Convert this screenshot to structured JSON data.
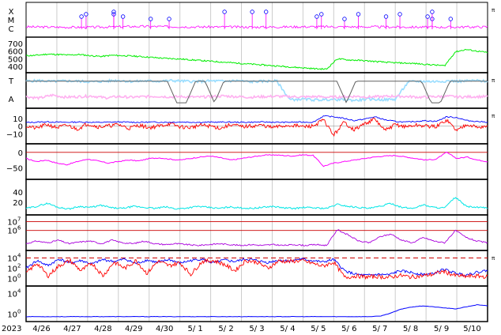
{
  "chart_data": {
    "type": "line",
    "year_label": "2023",
    "dates": [
      "4/26",
      "4/27",
      "4/28",
      "4/29",
      "4/30",
      "5/ 1",
      "5/ 2",
      "5/ 3",
      "5/ 4",
      "5/ 5",
      "5/ 6",
      "5/ 7",
      "5/ 8",
      "5/ 9",
      "5/10"
    ],
    "side_mark": "π",
    "colors": {
      "magenta": "#ff00ff",
      "green": "#00ee00",
      "lightblue": "#99ddff",
      "pink": "#ffb0f0",
      "gray": "#606060",
      "blue": "#0000ff",
      "red": "#ff0000",
      "purple": "#aa00dd",
      "cyan": "#00e6e6",
      "darkred": "#cc0000",
      "grid": "#cccccc"
    },
    "panels": [
      {
        "id": "flare",
        "row_labels": [
          "X",
          "M",
          "C"
        ],
        "side_mark": true,
        "event_markers": [
          0.19,
          0.72,
          0.12,
          0.88,
          0.43,
          0.81,
          0.21,
          0.69,
          0.52,
          0.64,
          0.78,
          0.31,
          0.49,
          0.13,
          0.63,
          0.27,
          0.88,
          0.19,
          0.87,
          0.92
        ]
      },
      {
        "id": "solar-wind-speed",
        "yticks": [
          "700",
          "600",
          "500",
          "400"
        ],
        "ylim": [
          350,
          750
        ],
        "series": [
          {
            "color_key": "green",
            "values": [
              540,
              545,
              560,
              555,
              548,
              555,
              540,
              530,
              545,
              540,
              535,
              525,
              515,
              505,
              500,
              490,
              480,
              470,
              460,
              450,
              440,
              430,
              420,
              410,
              400,
              390,
              380,
              370,
              365,
              500,
              485,
              480,
              470,
              460,
              450,
              445,
              440,
              430,
              420,
              410,
              590,
              620,
              600,
              580
            ]
          }
        ]
      },
      {
        "id": "imf-sector",
        "row_labels": [
          "T",
          "A"
        ],
        "side_mark": true,
        "ylim": [
          0,
          1
        ],
        "series": [
          {
            "color_key": "lightblue",
            "values": [
              0.8,
              0.82,
              0.79,
              0.81,
              0.8,
              0.78,
              0.8,
              0.83,
              0.79,
              0.81,
              0.8,
              0.82,
              0.8,
              0.79,
              0.81,
              0.8,
              0.82,
              0.78,
              0.8,
              0.81,
              0.2,
              0.22,
              0.19,
              0.21,
              0.2,
              0.18,
              0.22,
              0.2,
              0.21,
              0.78,
              0.8,
              0.79,
              0.81,
              0.8,
              0.82,
              0.8
            ]
          },
          {
            "color_key": "pink",
            "values": [
              0.3,
              0.25,
              0.35,
              0.28,
              0.3,
              0.32,
              0.26,
              0.3,
              0.28,
              0.3,
              0.31,
              0.29,
              0.3,
              0.28,
              0.3,
              0.32,
              0.3,
              0.28,
              0.3,
              0.31,
              0.3,
              0.29,
              0.3,
              0.28,
              0.3,
              0.31,
              0.29,
              0.3,
              0.32,
              0.3,
              0.28,
              0.3,
              0.31,
              0.29,
              0.3,
              0.3
            ]
          },
          {
            "color_key": "gray",
            "values": [
              0.8,
              0.8,
              0.8,
              0.8,
              0.8,
              0.8,
              0.8,
              0.8,
              0.8,
              0.8,
              0.8,
              0.8,
              0.8,
              0.8,
              0.8,
              0.8,
              0.1,
              0.1,
              0.8,
              0.8,
              0.1,
              0.8,
              0.8,
              0.8,
              0.8,
              0.8,
              0.8,
              0.8,
              0.8,
              0.8,
              0.8,
              0.8,
              0.8,
              0.8,
              0.1,
              0.8,
              0.8,
              0.8,
              0.8,
              0.8,
              0.8,
              0.8,
              0.8,
              0.1,
              0.1,
              0.8,
              0.8,
              0.8,
              0.8,
              0.8
            ]
          }
        ]
      },
      {
        "id": "imf-bt-bz",
        "yticks": [
          "10",
          "0",
          "−10"
        ],
        "ylim": [
          -20,
          20
        ],
        "side_mark": true,
        "series": [
          {
            "color_key": "blue",
            "values": [
              4.5,
              5,
              5.5,
              5,
              4.8,
              5.2,
              5,
              4.7,
              5,
              5.3,
              5,
              4.8,
              5.1,
              5,
              4.9,
              5.2,
              5,
              4.8,
              5,
              5.1,
              5,
              4.9,
              5,
              5.2,
              5,
              4.8,
              5,
              5.1,
              5,
              13,
              12,
              10,
              7,
              9,
              12,
              8,
              6,
              5,
              6,
              7,
              6,
              12,
              11,
              7,
              6,
              5
            ]
          },
          {
            "color_key": "red",
            "values": [
              0,
              -3,
              2,
              -2,
              1,
              -4,
              3,
              -1,
              0,
              2,
              -3,
              1,
              -2,
              0,
              3,
              -1,
              -2,
              1,
              0,
              -3,
              2,
              -1,
              0,
              1,
              -2,
              0,
              1,
              -1,
              0,
              8,
              -12,
              5,
              -5,
              3,
              9,
              -6,
              2,
              -1,
              1,
              0,
              -1,
              8,
              -6,
              3,
              -2,
              0
            ]
          }
        ]
      },
      {
        "id": "dst-index",
        "yticks": [
          "0",
          "−50"
        ],
        "ylim": [
          -80,
          20
        ],
        "series": [
          {
            "color_key": "magenta",
            "values": [
              -20,
              -30,
              -25,
              -35,
              -40,
              -30,
              -22,
              -28,
              -35,
              -30,
              -25,
              -28,
              -20,
              -18,
              -22,
              -25,
              -20,
              -15,
              -12,
              -18,
              -25,
              -20,
              -15,
              -10,
              -8,
              -10,
              -12,
              -8,
              -10,
              -45,
              -35,
              -30,
              -25,
              -20,
              -15,
              -12,
              -10,
              -15,
              -20,
              -25,
              -22,
              0,
              -20,
              -15,
              -25,
              -30
            ]
          }
        ]
      },
      {
        "id": "proton-density",
        "yticks": [
          "40",
          "20"
        ],
        "ylim": [
          0,
          60
        ],
        "series": [
          {
            "color_key": "cyan",
            "values": [
              8,
              12,
              18,
              10,
              7,
              12,
              10,
              14,
              9,
              8,
              12,
              10,
              8,
              11,
              7,
              9,
              12,
              10,
              8,
              11,
              9,
              8,
              10,
              12,
              9,
              8,
              10,
              9,
              8,
              16,
              12,
              10,
              8,
              12,
              18,
              10,
              8,
              15,
              10,
              9,
              30,
              12,
              10,
              9
            ]
          }
        ]
      },
      {
        "id": "electron-flux",
        "ticks": [
          "10",
          "10"
        ],
        "exponents": [
          "7",
          "6"
        ],
        "ylim": [
          4,
          7.5
        ],
        "reference_lines": [
          7,
          6
        ],
        "series": [
          {
            "color_key": "purple",
            "values": [
              4.5,
              4.8,
              4.6,
              4.9,
              4.5,
              4.7,
              4.8,
              4.5,
              4.9,
              4.6,
              4.5,
              4.8,
              4.5,
              4.4,
              4.5,
              4.4,
              4.3,
              4.4,
              4.5,
              4.4,
              4.3,
              4.4,
              4.3,
              4.4,
              4.3,
              4.4,
              4.3,
              4.4,
              4.3,
              6.1,
              5.5,
              4.8,
              4.6,
              5.3,
              5.6,
              4.9,
              4.6,
              5.2,
              4.8,
              4.6,
              6.0,
              5.2,
              4.8,
              4.6
            ]
          }
        ]
      },
      {
        "id": "proton-flux",
        "ticks": [
          "10",
          "10",
          "10"
        ],
        "exponents": [
          "4",
          "2",
          "0"
        ],
        "ylim": [
          -1,
          5
        ],
        "side_mark": true,
        "reference_line": 4,
        "series": [
          {
            "color_key": "blue",
            "values": [
              2,
              3.5,
              2.5,
              3.8,
              3,
              3.5,
              2.8,
              3.7,
              3.3,
              3.8,
              2.9,
              3.6,
              3.1,
              3.7,
              3,
              3.5,
              3.8,
              3,
              3.6,
              3.3,
              3.8,
              3.5,
              3.1,
              3.6,
              3.4,
              3.8,
              3.5,
              3.2,
              3.7,
              1.5,
              0.8,
              0.6,
              0.8,
              0.7,
              1.5,
              1.2,
              0.8,
              0.9,
              1.8,
              1.1,
              0.7,
              1.2,
              1.6
            ]
          },
          {
            "color_key": "red",
            "values": [
              1,
              3,
              0.5,
              2.5,
              3.5,
              1.5,
              3,
              0.5,
              3.2,
              2,
              3.5,
              1,
              3.4,
              2.5,
              3.1,
              0.8,
              3.3,
              3.5,
              2.8,
              1.5,
              3.5,
              3.2,
              2,
              3.4,
              3.3,
              3.5,
              3,
              2.4,
              3.2,
              0.2,
              0.5,
              0.3,
              0.4,
              0.2,
              0.6,
              0.3,
              0.5,
              0.8,
              1.4,
              0.6,
              0.4,
              0.5,
              0.3
            ]
          }
        ]
      },
      {
        "id": "high-energy",
        "ticks": [
          "10",
          "10"
        ],
        "exponents": [
          "4",
          "0"
        ],
        "ylim": [
          -1,
          5
        ],
        "series": [
          {
            "color_key": "blue",
            "values": [
              -0.5,
              -0.5,
              -0.5,
              -0.5,
              -0.5,
              -0.5,
              -0.5,
              -0.5,
              -0.5,
              -0.5,
              -0.5,
              -0.5,
              -0.5,
              -0.5,
              -0.5,
              -0.5,
              -0.5,
              -0.5,
              -0.5,
              -0.5,
              -0.5,
              -0.5,
              -0.5,
              -0.5,
              -0.5,
              -0.5,
              -0.5,
              -0.5,
              -0.5,
              -0.5,
              -0.5,
              -0.5,
              -0.5,
              -0.4,
              0.2,
              1.0,
              1.4,
              1.6,
              1.4,
              1.2,
              1.0,
              1.4,
              1.8,
              1.6
            ]
          }
        ]
      }
    ]
  }
}
